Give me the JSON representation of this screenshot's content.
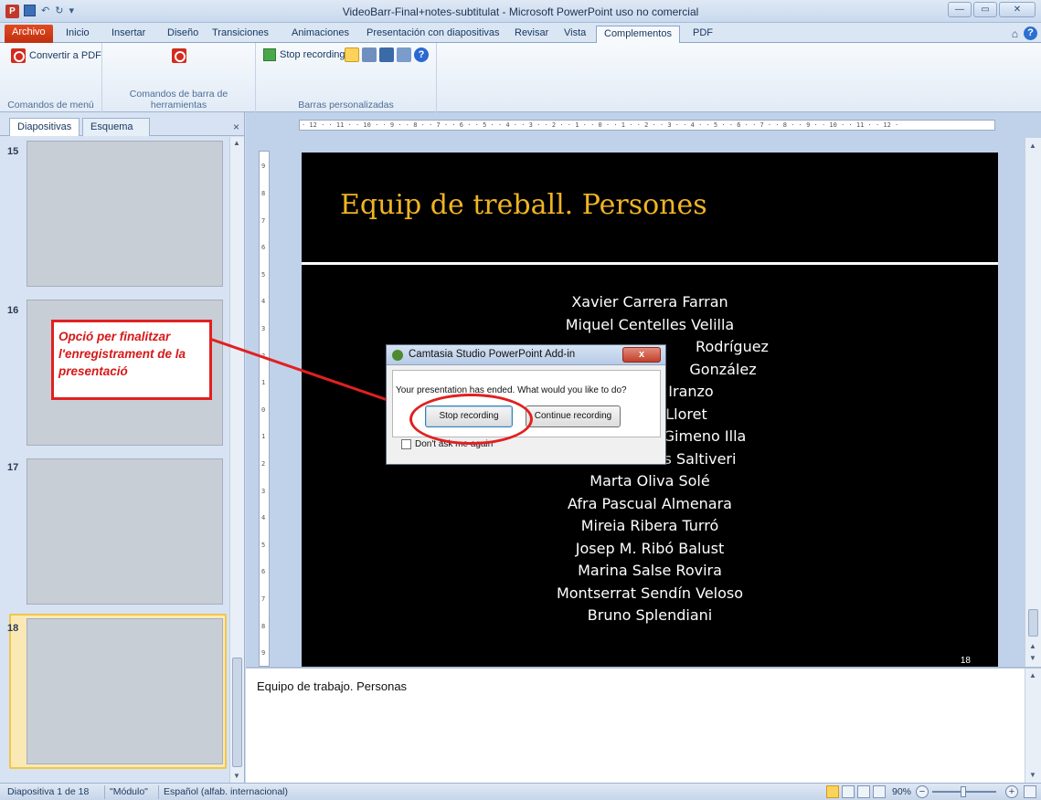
{
  "window": {
    "title": "VideoBarr-Final+notes-subtitulat - Microsoft PowerPoint uso no comercial",
    "app_icon": "P",
    "minimize": "—",
    "maximize": "▭",
    "close": "✕"
  },
  "ribbon": {
    "tabs": [
      "Archivo",
      "Inicio",
      "Insertar",
      "Diseño",
      "Transiciones",
      "Animaciones",
      "Presentación con diapositivas",
      "Revisar",
      "Vista",
      "Complementos",
      "PDF"
    ],
    "active_tab": "Complementos",
    "groups": {
      "menu_commands": {
        "label": "Comandos de menú",
        "button": "Convertir a PDF"
      },
      "toolbar_commands": {
        "label": "Comandos de barra de herramientas"
      },
      "custom_bars": {
        "label": "Barras personalizadas",
        "button": "Stop recording"
      }
    },
    "help": "?"
  },
  "left_panel": {
    "tabs": [
      "Diapositivas",
      "Esquema"
    ],
    "close": "×",
    "slide_numbers": [
      "15",
      "16",
      "17",
      "18"
    ]
  },
  "ruler": {
    "horizontal": "· 12 · · 11 · · 10 · · 9 · · 8 · · 7 · · 6 · · 5 · · 4 · · 3 · · 2 · · 1 · · 0 · · 1 · · 2 · · 3 · · 4 · · 5 · · 6 · · 7 · · 8 · · 9 · · 10 · · 11 · · 12 ·",
    "vertical": [
      "9",
      "8",
      "7",
      "6",
      "5",
      "4",
      "3",
      "2",
      "1",
      "0",
      "1",
      "2",
      "3",
      "4",
      "5",
      "6",
      "7",
      "8",
      "9"
    ]
  },
  "slide": {
    "title": "Equip de treball. Persones",
    "names": [
      "Xavier Carrera Farran",
      "Miquel Centelles Velilla",
      "Rodríguez",
      "González",
      "Iranzo",
      "Lloret",
      "Gimeno Illa",
      "s Saltiveri",
      "Marta Oliva Solé",
      "Afra Pascual Almenara",
      "Mireia Ribera Turró",
      "Josep M. Ribó Balust",
      "Marina Salse Rovira",
      "Montserrat Sendín Veloso",
      "Bruno Splendiani"
    ],
    "slide_number": "18"
  },
  "annotation": {
    "text": "Opció per finalitzar l'enregistrament de la presentació"
  },
  "dialog": {
    "title": "Camtasia Studio PowerPoint Add-in",
    "close": "x",
    "message": "Your presentation has ended. What would you like to do?",
    "stop_button": "Stop recording",
    "continue_button": "Continue recording",
    "checkbox_label": "Don't ask me again"
  },
  "notes": {
    "text": "Equipo de trabajo. Personas"
  },
  "statusbar": {
    "slide_info": "Diapositiva 1 de 18",
    "theme": "\"Módulo\"",
    "language": "Español (alfab. internacional)",
    "zoom": "90%",
    "zoom_out": "−",
    "zoom_in": "+"
  },
  "colors": {
    "slide_title": "#f0b423",
    "annotation": "#e12020",
    "file_tab": "#d0421a"
  }
}
